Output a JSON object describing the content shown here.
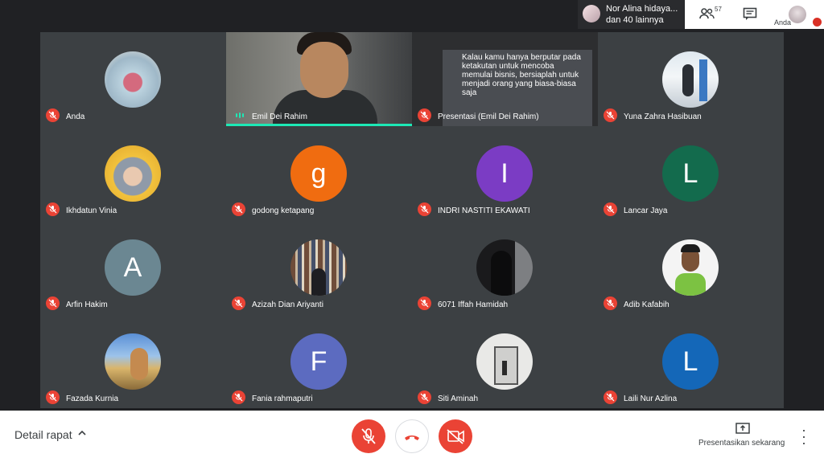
{
  "notification": {
    "line1": "Nor Alina hidaya...",
    "line2": "dan 40 lainnya"
  },
  "top_right": {
    "people_count": "57",
    "self_label": "Anda"
  },
  "tiles": [
    {
      "name": "Anda",
      "kind": "photo"
    },
    {
      "name": "Emil Dei Rahim",
      "kind": "video"
    },
    {
      "name": "Presentasi (Emil Dei Rahim)",
      "kind": "presentation"
    },
    {
      "name": "Yuna Zahra Hasibuan",
      "kind": "photo"
    },
    {
      "name": "Ikhdatun Vinia",
      "kind": "photo"
    },
    {
      "name": "godong ketapang",
      "kind": "letter",
      "letter": "g",
      "color": "#f06c10"
    },
    {
      "name": "INDRI NASTITI EKAWATI",
      "kind": "letter",
      "letter": "I",
      "color": "#7b3cc4"
    },
    {
      "name": "Lancar Jaya",
      "kind": "letter",
      "letter": "L",
      "color": "#136b4d"
    },
    {
      "name": "Arfin Hakim",
      "kind": "letter",
      "letter": "A",
      "color": "#6b8792"
    },
    {
      "name": "Azizah Dian Ariyanti",
      "kind": "photo"
    },
    {
      "name": "6071 Iffah Hamidah",
      "kind": "photo"
    },
    {
      "name": "Adib Kafabih",
      "kind": "photo"
    },
    {
      "name": "Fazada Kurnia",
      "kind": "photo"
    },
    {
      "name": "Fania rahmaputri",
      "kind": "letter",
      "letter": "F",
      "color": "#5c6bc0"
    },
    {
      "name": "Siti Aminah",
      "kind": "photo"
    },
    {
      "name": "Laili Nur Azlina",
      "kind": "letter",
      "letter": "L",
      "color": "#1467b8"
    }
  ],
  "slide_text": "Kalau kamu hanya berputar pada ketakutan untuk mencoba memulai bisnis, bersiaplah untuk menjadi orang yang biasa-biasa saja",
  "bottom": {
    "detail_label": "Detail rapat",
    "present_label": "Presentasikan sekarang"
  },
  "colors": {
    "mute_red": "#ea4335",
    "speaking_accent": "#1de9b6"
  },
  "icons": [
    "people-icon",
    "chat-icon",
    "mic-off-icon",
    "hangup-icon",
    "camera-off-icon",
    "present-icon",
    "more-icon",
    "chevron-up-icon"
  ]
}
